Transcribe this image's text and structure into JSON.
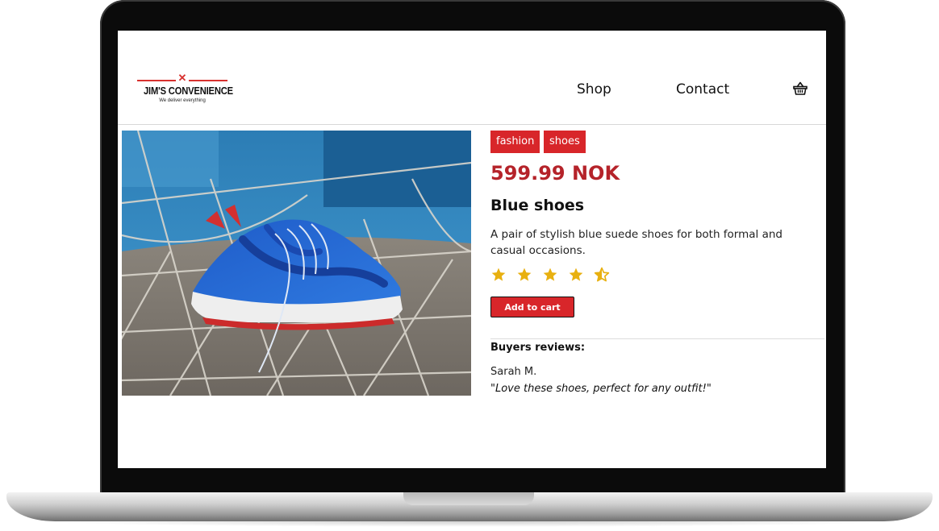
{
  "brand": {
    "name": "JIM'S CONVENIENCE",
    "tagline": "We deliver everything",
    "accent_color": "#d8312f"
  },
  "nav": {
    "items": [
      {
        "label": "Shop"
      },
      {
        "label": "Contact"
      }
    ],
    "cart_icon": "basket-icon"
  },
  "product": {
    "tags": [
      "fashion",
      "shoes"
    ],
    "price": "599.99 NOK",
    "name": "Blue shoes",
    "description": "A pair of stylish blue suede shoes for both formal and casual occasions.",
    "rating": 4.5,
    "rating_max": 5,
    "star_color": "#e8b010",
    "add_to_cart_label": "Add to cart",
    "button_color": "#d8262a",
    "price_color": "#b5232a",
    "image": "blue-sneaker-photo"
  },
  "reviews": {
    "heading": "Buyers reviews:",
    "items": [
      {
        "author": "Sarah M.",
        "text": "\"Love these shoes, perfect for any outfit!\""
      }
    ]
  }
}
